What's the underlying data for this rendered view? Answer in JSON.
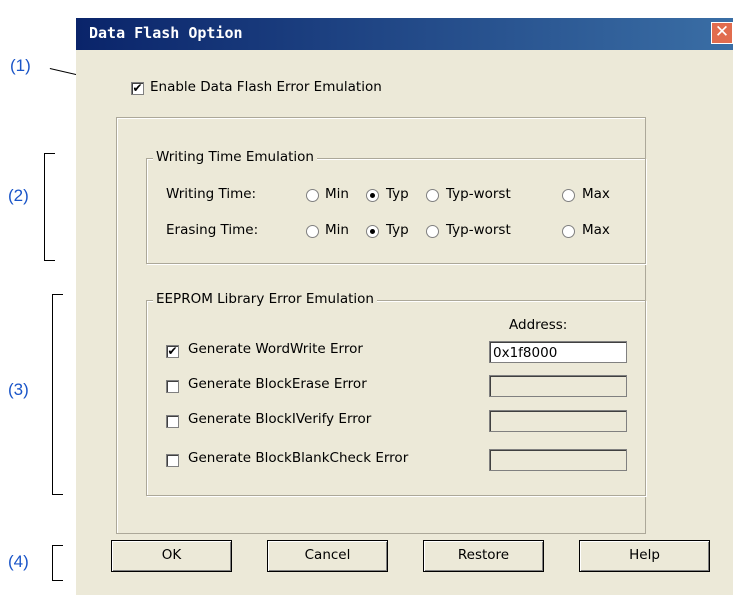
{
  "annotations": [
    "(1)",
    "(2)",
    "(3)",
    "(4)"
  ],
  "dialog": {
    "title": "Data Flash Option",
    "close_glyph": "✕"
  },
  "enable_emulation": {
    "label": "Enable Data Flash Error Emulation",
    "checked": true
  },
  "writing_time_group": {
    "legend": "Writing Time Emulation",
    "rows": [
      {
        "label": "Writing Time:",
        "options": [
          "Min",
          "Typ",
          "Typ-worst",
          "Max"
        ],
        "selected": "Typ"
      },
      {
        "label": "Erasing Time:",
        "options": [
          "Min",
          "Typ",
          "Typ-worst",
          "Max"
        ],
        "selected": "Typ"
      }
    ]
  },
  "eeprom_group": {
    "legend": "EEPROM Library Error Emulation",
    "address_header": "Address:",
    "rows": [
      {
        "label": "Generate WordWrite Error",
        "checked": true,
        "address": "0x1f8000",
        "enabled": true
      },
      {
        "label": "Generate BlockErase Error",
        "checked": false,
        "address": "",
        "enabled": false
      },
      {
        "label": "Generate BlockIVerify Error",
        "checked": false,
        "address": "",
        "enabled": false
      },
      {
        "label": "Generate BlockBlankCheck Error",
        "checked": false,
        "address": "",
        "enabled": false
      }
    ]
  },
  "buttons": {
    "ok": "OK",
    "cancel": "Cancel",
    "restore": "Restore",
    "help": "Help"
  },
  "colors": {
    "annotation": "#1a55c8",
    "dialog_bg": "#ece9d8",
    "title_bar": "#0a246a"
  }
}
